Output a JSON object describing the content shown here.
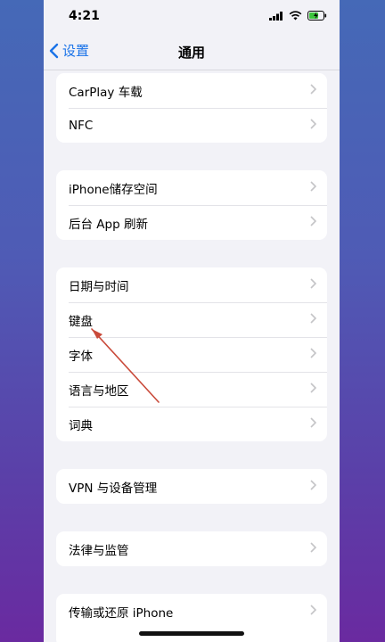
{
  "status_bar": {
    "time": "4:21"
  },
  "nav": {
    "back_label": "设置",
    "title": "通用"
  },
  "groups": [
    {
      "items": [
        "CarPlay 车载",
        "NFC"
      ]
    },
    {
      "items": [
        "iPhone储存空间",
        "后台 App 刷新"
      ]
    },
    {
      "items": [
        "日期与时间",
        "键盘",
        "字体",
        "语言与地区",
        "词典"
      ]
    },
    {
      "items": [
        "VPN 与设备管理"
      ]
    },
    {
      "items": [
        "法律与监管"
      ]
    },
    {
      "items": [
        "传输或还原 iPhone"
      ]
    }
  ],
  "colors": {
    "accent": "#1a73e8",
    "annotation_arrow": "#c94a3a",
    "background": "#f2f2f7"
  }
}
